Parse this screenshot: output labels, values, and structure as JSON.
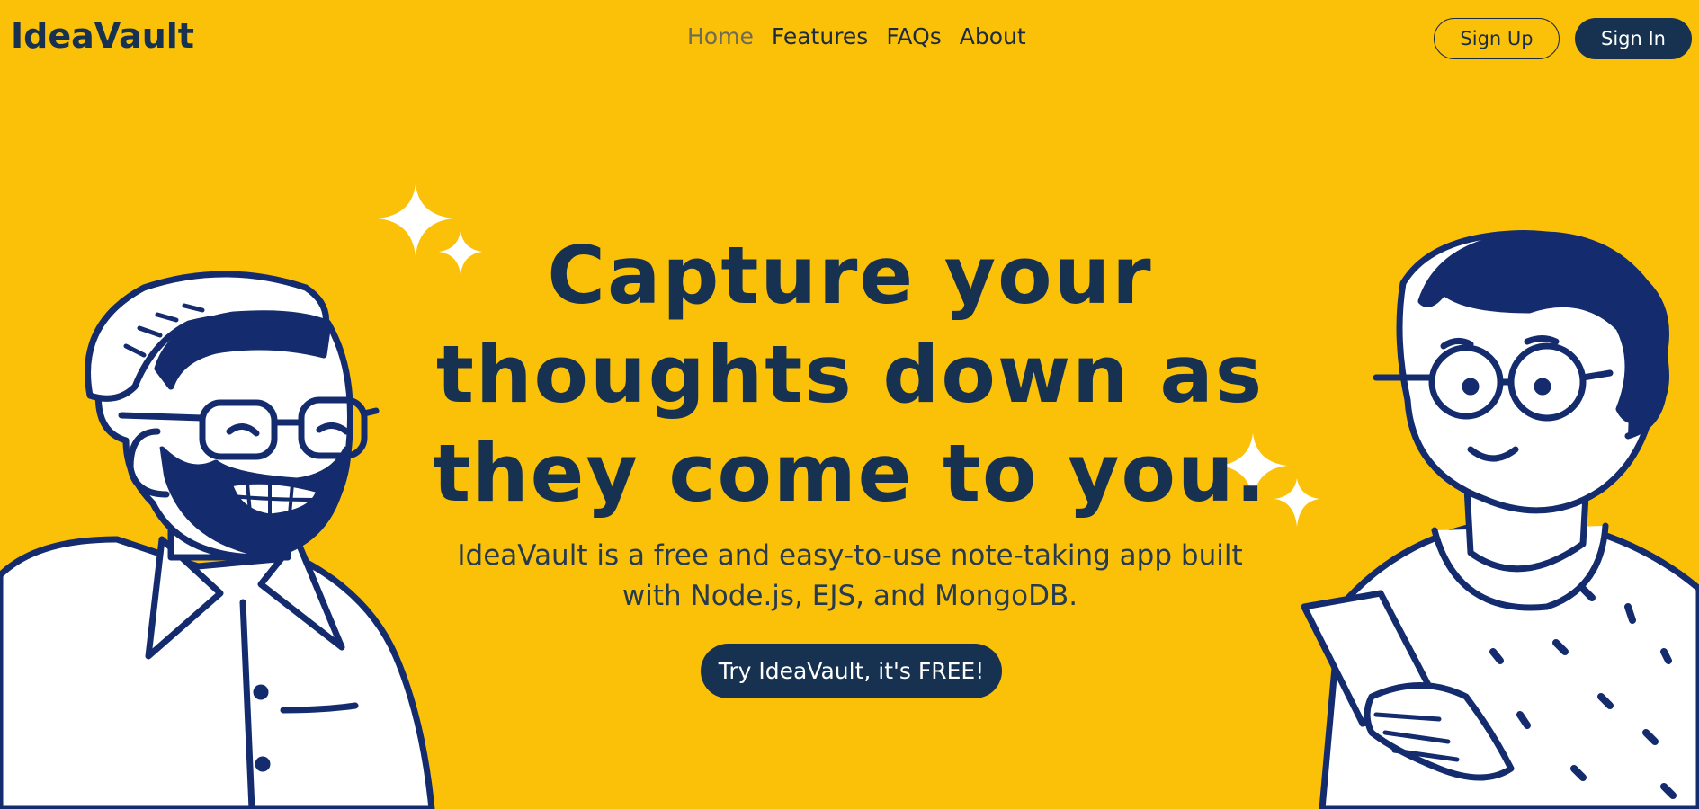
{
  "brand": {
    "name": "IdeaVault"
  },
  "nav": {
    "items": [
      {
        "label": "Home",
        "active": true
      },
      {
        "label": "Features"
      },
      {
        "label": "FAQs"
      },
      {
        "label": "About"
      }
    ]
  },
  "auth": {
    "signup_label": "Sign Up",
    "signin_label": "Sign In"
  },
  "hero": {
    "headline_lines": [
      "Capture your",
      "thoughts down as",
      "they come to you."
    ],
    "subtitle_lines": [
      "IdeaVault is a free and easy-to-use note-taking app built",
      "with Node.js, EJS, and MongoDB."
    ],
    "cta_label": "Try IdeaVault, it's FREE!"
  },
  "colors": {
    "background": "#fbc108",
    "primary": "#163250",
    "illustration_stroke": "#142c6e",
    "white": "#ffffff"
  },
  "illustrations": {
    "left": "bearded-man-illustration",
    "right": "woman-with-phone-illustration",
    "sparkles": "sparkle-icon"
  }
}
